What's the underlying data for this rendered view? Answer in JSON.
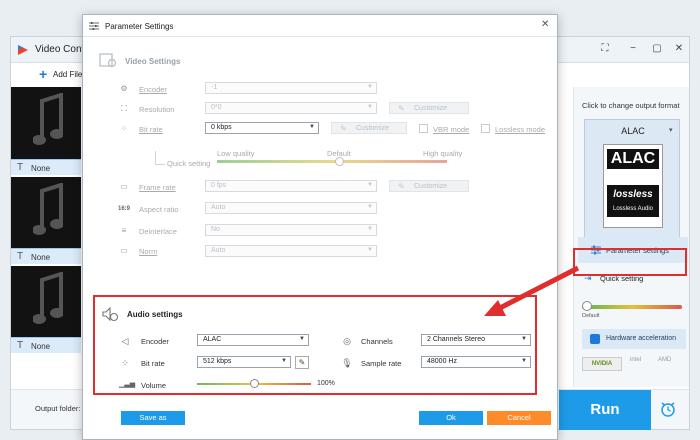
{
  "app": {
    "title": "Video Conv",
    "add_files": "Add File",
    "subtitle_none": "None",
    "right_panel": {
      "click_change": "Click to change output format",
      "format_name": "ALAC",
      "format_logo_text": "ALAC",
      "lossless_word": "lossless",
      "lossless_audio": "Lossless Audio",
      "parameter_settings": "Parameter settings",
      "quick_setting": "Quick setting",
      "default_label": "Default",
      "hardware_acceleration": "Hardware acceleration",
      "nvidia": "NVIDIA",
      "intel": "intel",
      "amd": "AMD"
    },
    "output_folder": "Output folder:",
    "run": "Run",
    "accent_color": "#1e9be8"
  },
  "dialog": {
    "title": "Parameter Settings",
    "video": {
      "title": "Video Settings",
      "encoder_label": "Encoder",
      "encoder_value": "-1",
      "resolution_label": "Resolution",
      "resolution_value": "0*0",
      "customize": "Customize",
      "bitrate_label": "Bit rate",
      "bitrate_value": "0 kbps",
      "vbr_mode": "VBR mode",
      "lossless_mode": "Lossless mode",
      "quick_setting": "Quick setting",
      "low_quality": "Low quality",
      "default": "Default",
      "high_quality": "High quality",
      "framerate_label": "Frame rate",
      "framerate_value": "0 fps",
      "aspect_label": "Aspect ratio",
      "aspect_value": "Auto",
      "deinterlace_label": "Deinterlace",
      "deinterlace_value": "No",
      "norm_label": "Norm",
      "norm_value": "Auto"
    },
    "audio": {
      "title": "Audio settings",
      "encoder_label": "Encoder",
      "encoder_value": "ALAC",
      "channels_label": "Channels",
      "channels_value": "2 Channels Stereo",
      "bitrate_label": "Bit rate",
      "bitrate_value": "512 kbps",
      "samplerate_label": "Sample rate",
      "samplerate_value": "48000 Hz",
      "volume_label": "Volume",
      "volume_pct": "100%",
      "volume_level": 0.5
    },
    "save_as": "Save as",
    "ok": "Ok",
    "cancel": "Cancel",
    "highlight_color": "#e02d2d",
    "cancel_color": "#ff8a2a"
  }
}
